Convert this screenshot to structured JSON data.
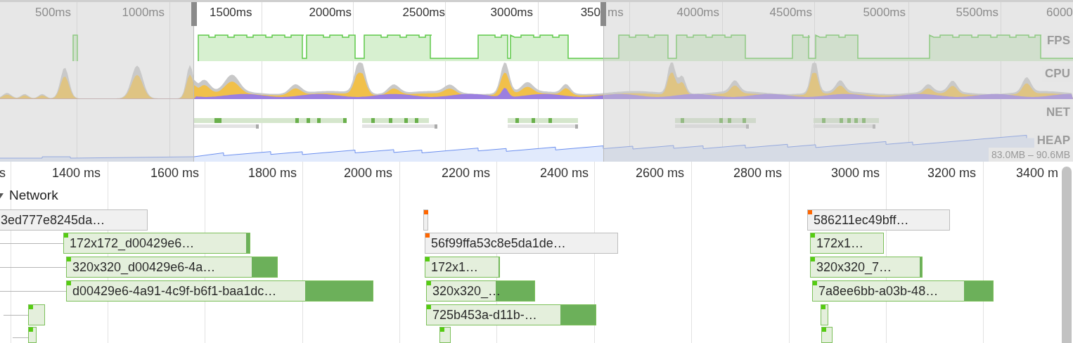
{
  "overview": {
    "ticks": [
      "500ms",
      "1000ms",
      "1500ms",
      "2000ms",
      "2500ms",
      "3000ms",
      "350",
      "ms",
      "4000ms",
      "4500ms",
      "5000ms",
      "5500ms",
      "6000"
    ],
    "tracks": [
      {
        "label": "FPS"
      },
      {
        "label": "CPU"
      },
      {
        "label": "NET"
      },
      {
        "label": "HEAP"
      }
    ],
    "heap_range": "83.0MB – 90.6MB"
  },
  "timeline": {
    "ticks": [
      "s",
      "1400 ms",
      "1600 ms",
      "1800 ms",
      "2000 ms",
      "2200 ms",
      "2400 ms",
      "2600 ms",
      "2800 ms",
      "3000 ms",
      "3200 ms",
      "3400 m"
    ]
  },
  "network": {
    "title": "Network",
    "expanded": true,
    "requests": [
      {
        "label": "3ed777e8245da…",
        "kind": "other"
      },
      {
        "label": "172x172_d00429e6…",
        "kind": "image",
        "color": "#55cc11",
        "level": 0.02
      },
      {
        "label": "320x320_d00429e6-4a…",
        "kind": "image",
        "color": "#55cc11",
        "level": 0.12
      },
      {
        "label": "d00429e6-4a91-4c9f-b6f1-baa1dc…",
        "kind": "image",
        "color": "#55cc11",
        "level": 0.22
      },
      {
        "kind": "image",
        "color": "#55cc11"
      },
      {
        "kind": "image",
        "color": "#55cc11"
      },
      {
        "kind": "other",
        "color": "#ff6600"
      },
      {
        "label": "56f99ffa53c8e5da1de…",
        "kind": "other",
        "color": "#ff6600"
      },
      {
        "label": "172x1…",
        "kind": "image",
        "color": "#55cc11",
        "level": 0.01
      },
      {
        "label": "320x320_…",
        "kind": "image",
        "color": "#55cc11",
        "level": 0.36
      },
      {
        "label": "725b453a-d11b-…",
        "kind": "image",
        "color": "#55cc11",
        "level": 0.21
      },
      {
        "kind": "image",
        "color": "#55cc11"
      },
      {
        "label": "586211ec49bff…",
        "kind": "other",
        "color": "#ff6600"
      },
      {
        "label": "172x1…",
        "kind": "image",
        "color": "#55cc11"
      },
      {
        "label": "320x320_7…",
        "kind": "image",
        "color": "#55cc11",
        "level": 0.02
      },
      {
        "label": "7a8ee6bb-a03b-48…",
        "kind": "image",
        "color": "#55cc11",
        "level": 0.16
      },
      {
        "kind": "image",
        "color": "#55cc11"
      },
      {
        "kind": "image",
        "color": "#55cc11"
      }
    ]
  }
}
